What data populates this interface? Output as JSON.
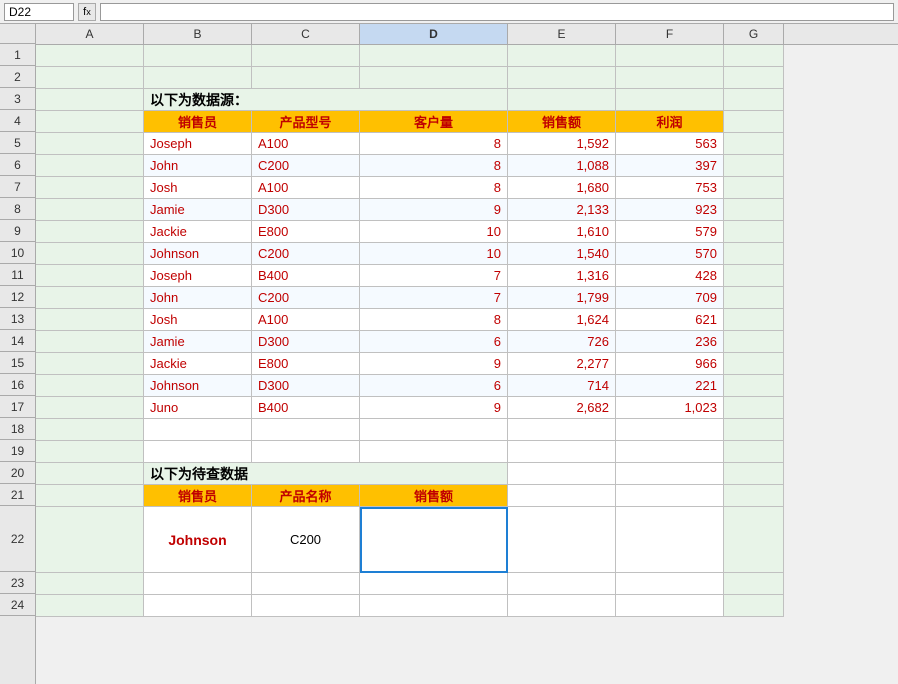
{
  "formulaBar": {
    "cellRef": "D22",
    "formula": ""
  },
  "columns": {
    "widths": [
      36,
      108,
      108,
      108,
      148,
      108,
      108,
      60
    ],
    "labels": [
      "",
      "A",
      "B",
      "C",
      "D",
      "E",
      "F",
      "G"
    ]
  },
  "rows": {
    "count": 24,
    "heights": [
      22,
      22,
      22,
      22,
      22,
      22,
      22,
      22,
      22,
      22,
      22,
      22,
      22,
      22,
      22,
      22,
      22,
      22,
      22,
      22,
      22,
      22,
      66,
      22,
      22
    ]
  },
  "section1Label": "以下为数据源：",
  "section2Label": "以下为待查数据",
  "tableHeader": {
    "col1": "销售员",
    "col2": "产品型号",
    "col3": "客户量",
    "col4": "销售额",
    "col5": "利润"
  },
  "tableData": [
    {
      "name": "Joseph",
      "product": "A100",
      "customers": "8",
      "sales": "1,592",
      "profit": "563"
    },
    {
      "name": "John",
      "product": "C200",
      "customers": "8",
      "sales": "1,088",
      "profit": "397"
    },
    {
      "name": "Josh",
      "product": "A100",
      "customers": "8",
      "sales": "1,680",
      "profit": "753"
    },
    {
      "name": "Jamie",
      "product": "D300",
      "customers": "9",
      "sales": "2,133",
      "profit": "923"
    },
    {
      "name": "Jackie",
      "product": "E800",
      "customers": "10",
      "sales": "1,610",
      "profit": "579"
    },
    {
      "name": "Johnson",
      "product": "C200",
      "customers": "10",
      "sales": "1,540",
      "profit": "570"
    },
    {
      "name": "Joseph",
      "product": "B400",
      "customers": "7",
      "sales": "1,316",
      "profit": "428"
    },
    {
      "name": "John",
      "product": "C200",
      "customers": "7",
      "sales": "1,799",
      "profit": "709"
    },
    {
      "name": "Josh",
      "product": "A100",
      "customers": "8",
      "sales": "1,624",
      "profit": "621"
    },
    {
      "name": "Jamie",
      "product": "D300",
      "customers": "6",
      "sales": "726",
      "profit": "236"
    },
    {
      "name": "Jackie",
      "product": "E800",
      "customers": "9",
      "sales": "2,277",
      "profit": "966"
    },
    {
      "name": "Johnson",
      "product": "D300",
      "customers": "6",
      "sales": "714",
      "profit": "221"
    },
    {
      "name": "Juno",
      "product": "B400",
      "customers": "9",
      "sales": "2,682",
      "profit": "1,023"
    }
  ],
  "queryTableHeader": {
    "col1": "销售员",
    "col2": "产品名称",
    "col3": "销售额"
  },
  "queryData": {
    "name": "Johnson",
    "product": "C200",
    "sales": ""
  }
}
